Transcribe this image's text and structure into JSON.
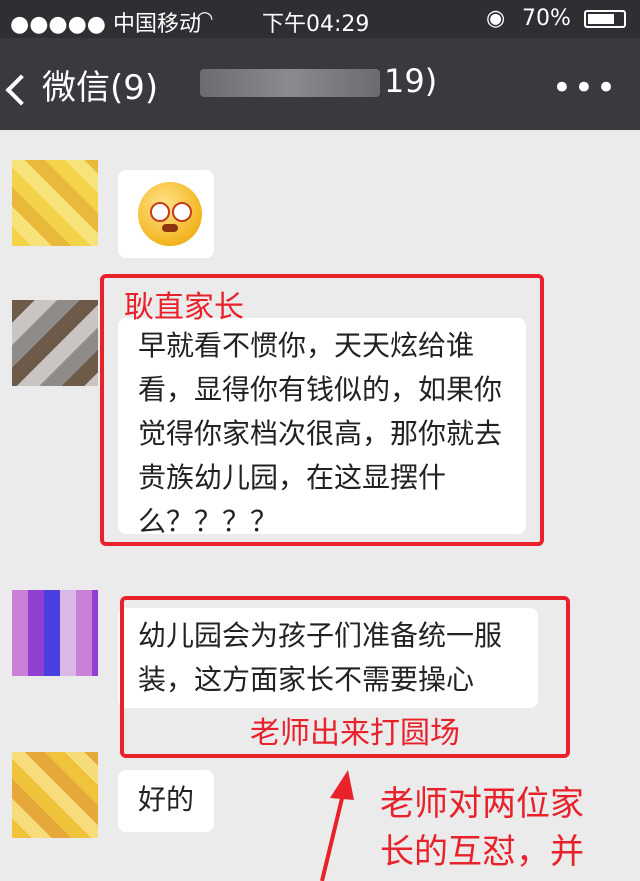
{
  "status_bar": {
    "carrier": "●●●●● 中国移动",
    "time": "下午04:29",
    "battery": "70%"
  },
  "nav": {
    "back_label": "微信(9)",
    "title_suffix": "19)",
    "more_label": "•••"
  },
  "messages": [
    {
      "type": "sticker",
      "icon": "angry-face-sticker"
    },
    {
      "type": "text",
      "lines": [
        "早就看不惯你，天天炫给谁",
        "看，显得你有钱似的，如果你",
        "觉得你家档次很高，那你就去",
        "贵族幼儿园，在这显摆什",
        "么？？？？"
      ]
    },
    {
      "type": "text",
      "lines": [
        "幼儿园会为孩子们准备统一服",
        "装，这方面家长不需要操心"
      ]
    },
    {
      "type": "text",
      "lines": [
        "好的"
      ]
    }
  ],
  "annotations": {
    "label_1": "耿直家长",
    "label_2": "老师出来打圆场",
    "label_3_line1": "老师对两位家",
    "label_3_line2": "长的互怼，并",
    "accent_color": "#e8212b"
  }
}
